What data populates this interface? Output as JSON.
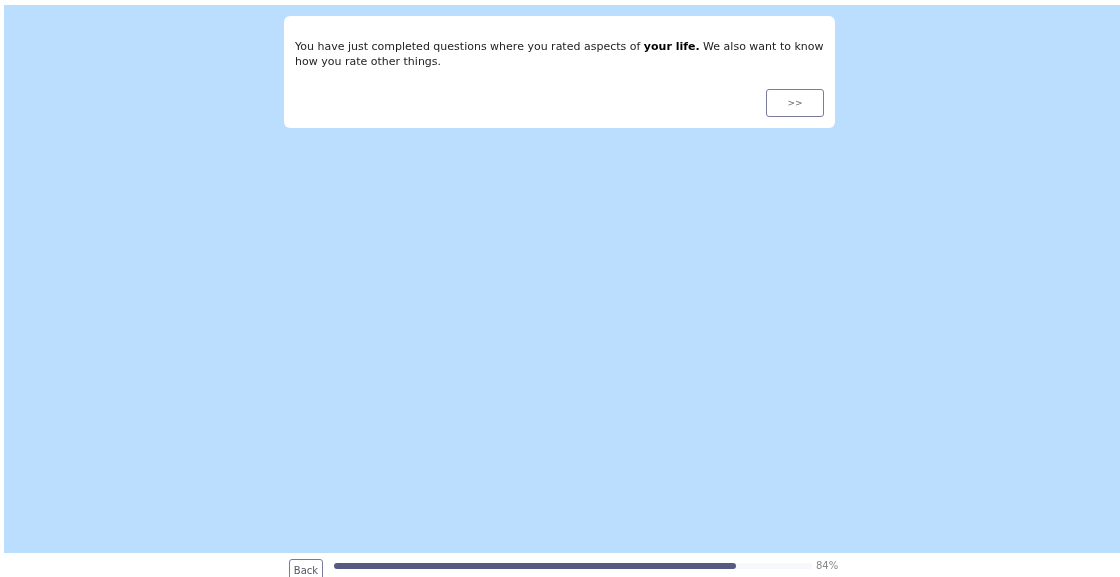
{
  "question": {
    "text": "You have just completed questions where you rated aspects of **your life.** We also want to know how you rate other things.",
    "next_button": ">>"
  },
  "footer": {
    "back_button": "Back",
    "progress": {
      "level": 0.84,
      "reading": "84%"
    }
  }
}
